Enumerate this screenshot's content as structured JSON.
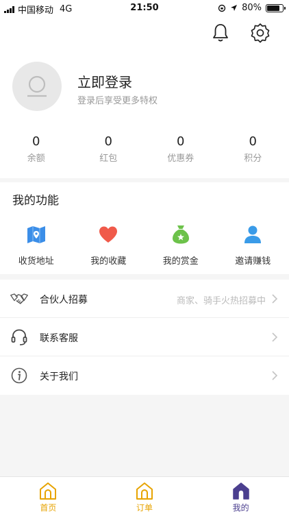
{
  "status_bar": {
    "carrier": "中国移动",
    "network": "4G",
    "time": "21:50",
    "battery": "80%",
    "battery_level": 0.8
  },
  "header": {
    "bell_icon": "bell-icon",
    "settings_icon": "gear-icon",
    "login_title": "立即登录",
    "login_subtitle": "登录后享受更多特权"
  },
  "stats": [
    {
      "value": "0",
      "label": "余额"
    },
    {
      "value": "0",
      "label": "红包"
    },
    {
      "value": "0",
      "label": "优惠券"
    },
    {
      "value": "0",
      "label": "积分"
    }
  ],
  "functions": {
    "title": "我的功能",
    "items": [
      {
        "label": "收货地址",
        "icon": "map-icon"
      },
      {
        "label": "我的收藏",
        "icon": "heart-icon"
      },
      {
        "label": "我的赏金",
        "icon": "money-bag-icon"
      },
      {
        "label": "邀请赚钱",
        "icon": "user-icon"
      }
    ]
  },
  "menu": [
    {
      "label": "合伙人招募",
      "hint": "商家、骑手火热招募中",
      "icon": "handshake-icon"
    },
    {
      "label": "联系客服",
      "hint": "",
      "icon": "headset-icon"
    },
    {
      "label": "关于我们",
      "hint": "",
      "icon": "info-icon"
    }
  ],
  "tabs": [
    {
      "label": "首页",
      "icon": "home-icon"
    },
    {
      "label": "订单",
      "icon": "home-icon"
    },
    {
      "label": "我的",
      "icon": "home-icon"
    }
  ],
  "colors": {
    "accent_yellow": "#e7a300",
    "active_purple": "#4b3f8f",
    "map_blue": "#3b8ee8",
    "heart_red": "#f05a4a",
    "bag_green": "#6cc24a",
    "user_blue": "#3a9be8"
  }
}
